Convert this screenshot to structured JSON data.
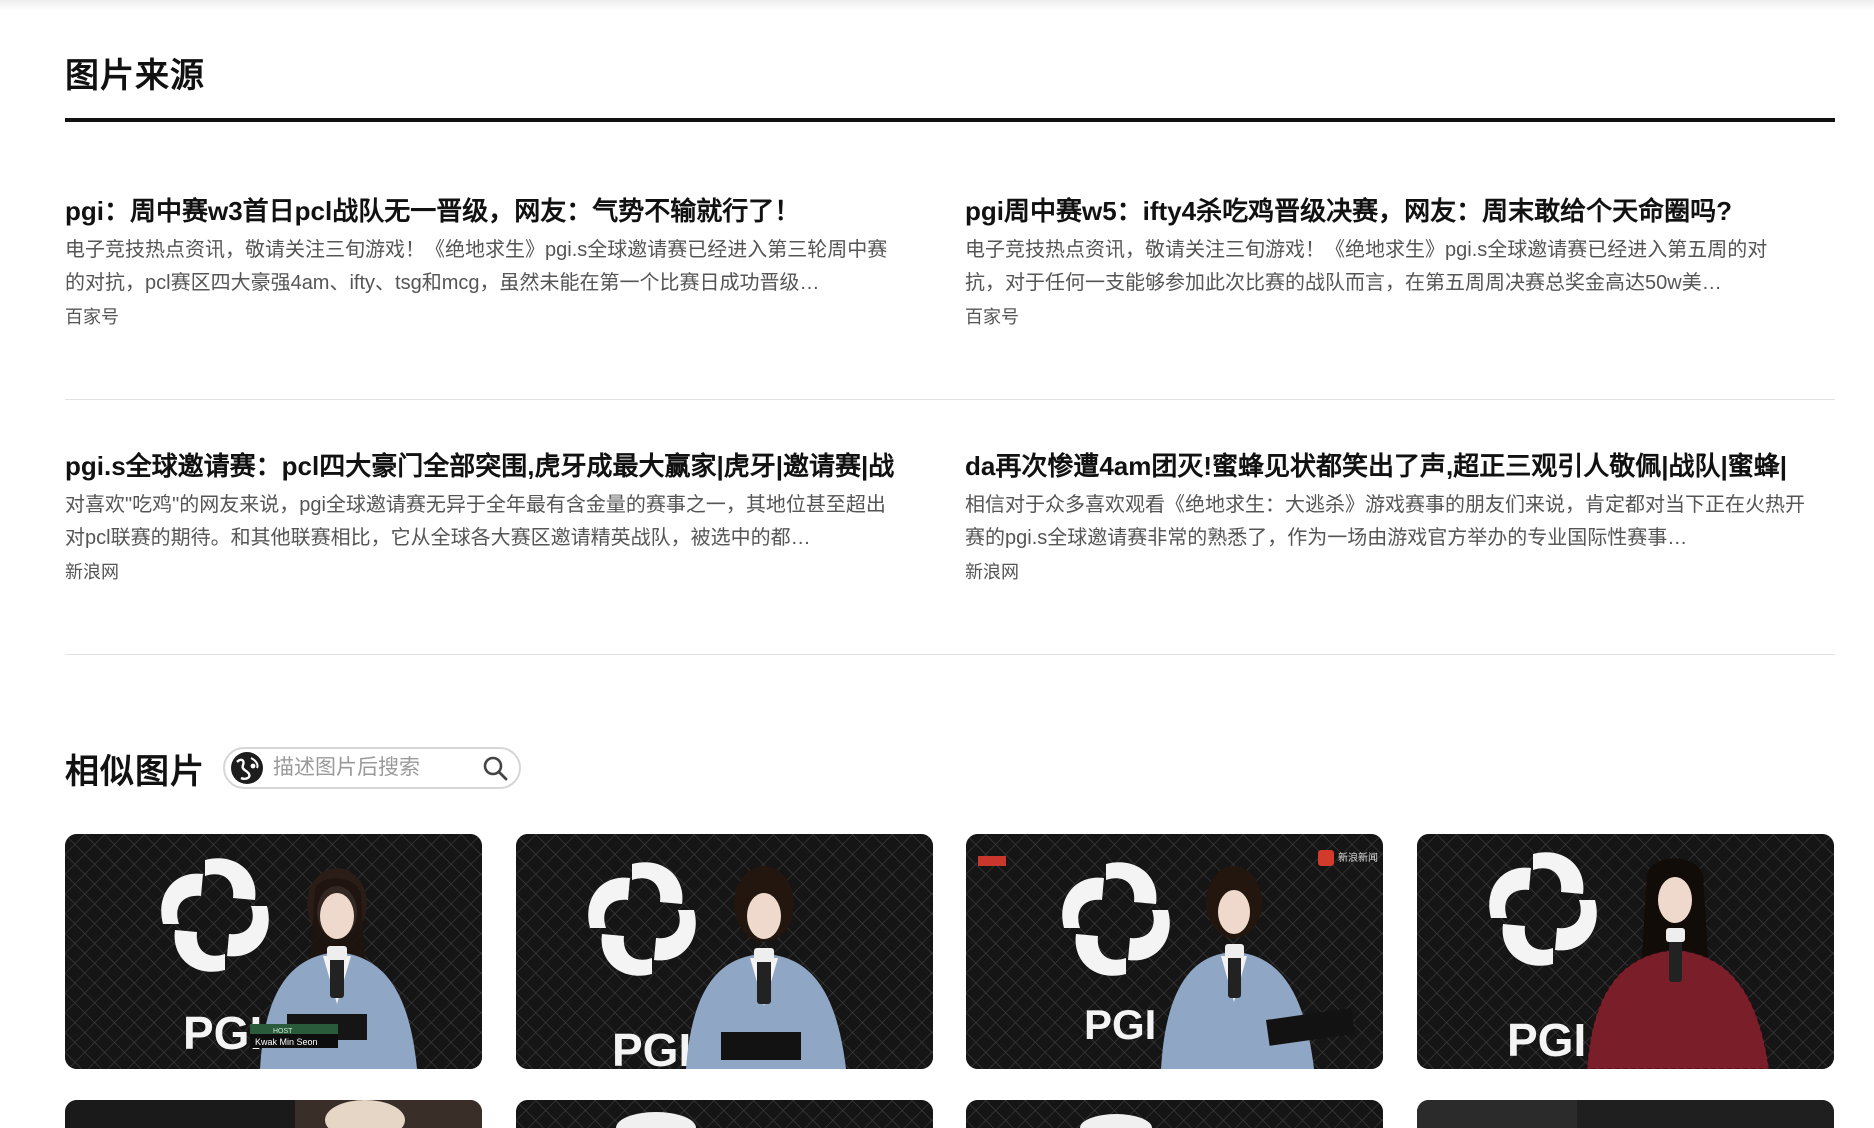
{
  "source_section": {
    "title": "图片来源",
    "articles": [
      {
        "title": "pgi：周中赛w3首日pcl战队无一晋级，网友：气势不输就行了！",
        "summary": "电子竞技热点资讯，敬请关注三旬游戏！《绝地求生》pgi.s全球邀请赛已经进入第三轮周中赛的对抗，pcl赛区四大豪强4am、ifty、tsg和mcg，虽然未能在第一个比赛日成功晋级…",
        "source": "百家号"
      },
      {
        "title": "pgi周中赛w5：ifty4杀吃鸡晋级决赛，网友：周末敢给个天命圈吗?",
        "summary": "电子竞技热点资讯，敬请关注三旬游戏！《绝地求生》pgi.s全球邀请赛已经进入第五周的对抗，对于任何一支能够参加此次比赛的战队而言，在第五周周决赛总奖金高达50w美…",
        "source": "百家号"
      },
      {
        "title": "pgi.s全球邀请赛：pcl四大豪门全部突围,虎牙成最大赢家|虎牙|邀请赛|战",
        "summary": "对喜欢\"吃鸡\"的网友来说，pgi全球邀请赛无异于全年最有含金量的赛事之一，其地位甚至超出对pcl联赛的期待。和其他联赛相比，它从全球各大赛区邀请精英战队，被选中的都…",
        "source": "新浪网"
      },
      {
        "title": "da再次惨遭4am团灭!蜜蜂见状都笑出了声,超正三观引人敬佩|战队|蜜蜂|",
        "summary": "相信对于众多喜欢观看《绝地求生：大逃杀》游戏赛事的朋友们来说，肯定都对当下正在火热开赛的pgi.s全球邀请赛非常的熟悉了，作为一场由游戏官方举办的专业国际性赛事…",
        "source": "新浪网"
      }
    ]
  },
  "similar_section": {
    "title": "相似图片",
    "search_placeholder": "描述图片后搜索",
    "images": [
      {
        "logo_text": "PGI",
        "caption_line1": "HOST",
        "caption_line2": "Kwak Min Seon",
        "jacket": "blue"
      },
      {
        "logo_text": "PGI",
        "jacket": "blue"
      },
      {
        "logo_text": "PGI",
        "corner_label": "新浪新闻",
        "jacket": "blue"
      },
      {
        "logo_text": "PGI",
        "jacket": "red"
      }
    ]
  }
}
